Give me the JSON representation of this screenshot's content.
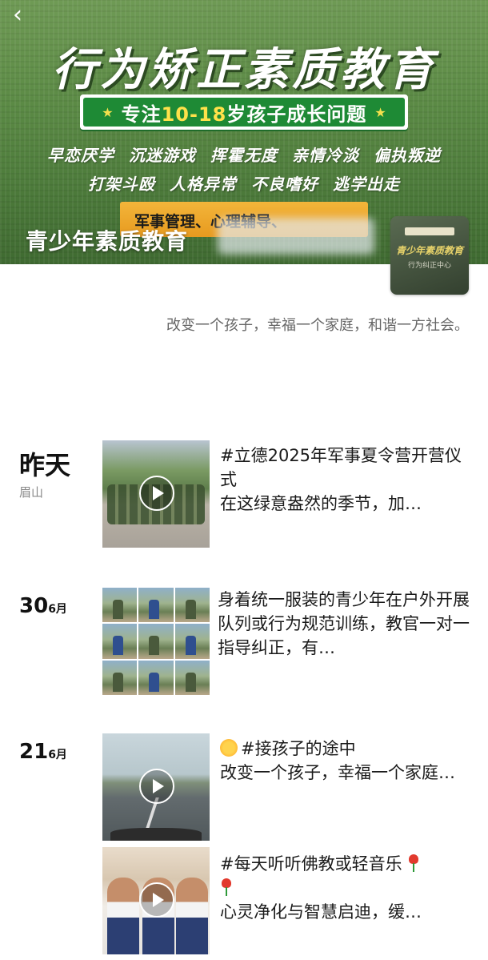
{
  "cover": {
    "headline": "行为矫正素质教育",
    "ribbon_pre": "专注",
    "ribbon_hl": "10-18",
    "ribbon_post": "岁孩子成长问题",
    "tags_row1": [
      "早恋厌学",
      "沉迷游戏",
      "挥霍无度",
      "亲情冷淡",
      "偏执叛逆"
    ],
    "tags_row2": [
      "打架斗殴",
      "人格异常",
      "不良嗜好",
      "逃学出走"
    ],
    "orange_text": "军事管理、心理辅导、",
    "account_name": "青少年素质教育"
  },
  "avatar": {
    "title": "青少年素质教育",
    "subtitle": "行为纠正中心"
  },
  "signature": "改变一个孩子，幸福一个家庭，和谐一方社会。",
  "posts": [
    {
      "date": "昨天",
      "location": "眉山",
      "text": "#立德2025年军事夏令营开营仪式\n在这绿意盎然的季节，加…"
    },
    {
      "date_day": "30",
      "date_month": "6月",
      "text": "身着统一服装的青少年在户外开展队列或行为规范训练，教官一对一指导纠正，有…"
    },
    {
      "date_day": "21",
      "date_month": "6月",
      "text": "#接孩子的途中\n改变一个孩子，幸福一个家庭…"
    },
    {
      "text_line1": "#每天听听佛教或轻音乐",
      "text_line3": "心灵净化与智慧启迪，缓…"
    }
  ]
}
